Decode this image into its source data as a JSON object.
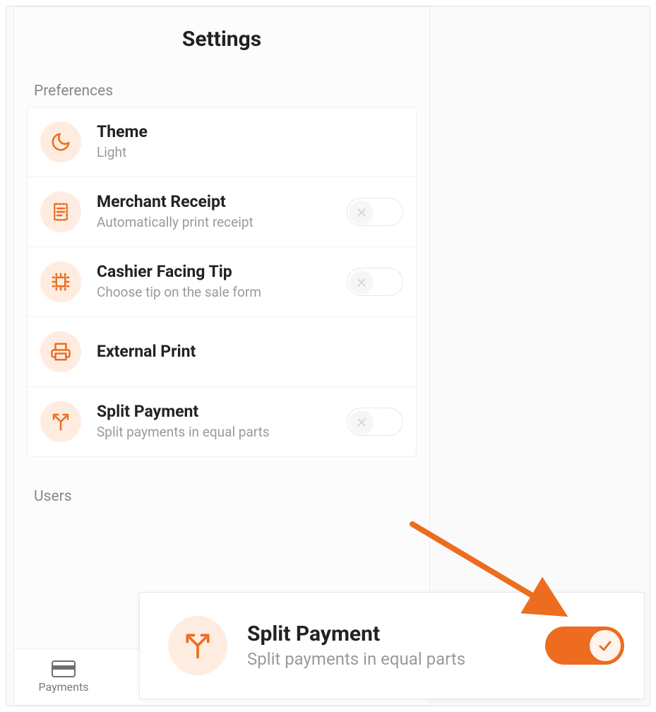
{
  "title": "Settings",
  "sections": {
    "preferences": {
      "label": "Preferences",
      "items": [
        {
          "icon": "moon",
          "title": "Theme",
          "sub": "Light"
        },
        {
          "icon": "receipt",
          "title": "Merchant Receipt",
          "sub": "Automatically print receipt",
          "toggle": false
        },
        {
          "icon": "chip",
          "title": "Cashier Facing Tip",
          "sub": "Choose tip on the sale form",
          "toggle": false
        },
        {
          "icon": "printer",
          "title": "External Print"
        },
        {
          "icon": "split",
          "title": "Split Payment",
          "sub": "Split payments in equal parts",
          "toggle": false
        }
      ]
    },
    "users": {
      "label": "Users"
    }
  },
  "nav": {
    "payments": "Payments"
  },
  "callout": {
    "icon": "split",
    "title": "Split Payment",
    "sub": "Split payments in equal parts",
    "toggle": true
  }
}
